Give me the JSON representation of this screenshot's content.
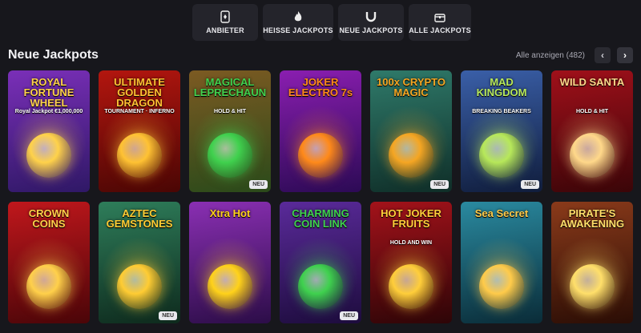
{
  "tabs": [
    {
      "label": "ANBIETER",
      "icon": "provider-icon"
    },
    {
      "label": "HEISSE JACKPOTS",
      "icon": "fire-icon"
    },
    {
      "label": "NEUE JACKPOTS",
      "icon": "horseshoe-icon"
    },
    {
      "label": "ALLE JACKPOTS",
      "icon": "treasure-chest-icon"
    }
  ],
  "section": {
    "title": "Neue Jackpots",
    "show_all": "Alle anzeigen (482)"
  },
  "badge_new": "NEU",
  "games": [
    {
      "title": "ROYAL FORTUNE WHEEL",
      "sub": "Royal Jackpot €1,000,000",
      "bg": "#7a2fb8",
      "bg2": "#2f1866",
      "accent": "#ffd24a",
      "new": false
    },
    {
      "title": "ULTIMATE GOLDEN DRAGON",
      "sub": "TOURNAMENT · INFERNO",
      "bg": "#b3160f",
      "bg2": "#4a0604",
      "accent": "#ffc233",
      "new": false
    },
    {
      "title": "MAGICAL LEPRECHAUN",
      "sub": "HOLD & HIT",
      "bg": "#7c5a22",
      "bg2": "#2a4a1a",
      "accent": "#40d14e",
      "new": true
    },
    {
      "title": "JOKER ELECTRO 7s",
      "sub": "",
      "bg": "#8a1eb0",
      "bg2": "#2c0a55",
      "accent": "#ff8a1a",
      "new": false
    },
    {
      "title": "100x CRYPTO MAGIC",
      "sub": "",
      "bg": "#2f7a6a",
      "bg2": "#0f2e28",
      "accent": "#f5a623",
      "new": true
    },
    {
      "title": "MAD KINGDOM",
      "sub": "BREAKING BEAKERS",
      "bg": "#3a5fa8",
      "bg2": "#101d3c",
      "accent": "#b7e85a",
      "new": true
    },
    {
      "title": "WILD SANTA",
      "sub": "HOLD & HIT",
      "bg": "#a0101a",
      "bg2": "#3a0508",
      "accent": "#ffd88a",
      "new": false
    },
    {
      "title": "CROWN COINS",
      "sub": "",
      "bg": "#c0171c",
      "bg2": "#4a0508",
      "accent": "#ffd04a",
      "new": false
    },
    {
      "title": "AZTEC GEMSTONES",
      "sub": "",
      "bg": "#2e7d5a",
      "bg2": "#0e2a1d",
      "accent": "#ffcc33",
      "new": true
    },
    {
      "title": "Xtra Hot",
      "sub": "",
      "bg": "#8a2fb3",
      "bg2": "#2c0d48",
      "accent": "#ffd21a",
      "new": false
    },
    {
      "title": "CHARMING COIN LINK",
      "sub": "",
      "bg": "#5a2a9a",
      "bg2": "#1d0c3d",
      "accent": "#3fd14e",
      "new": true
    },
    {
      "title": "HOT JOKER FRUITS",
      "sub": "HOLD AND WIN",
      "bg": "#a3121a",
      "bg2": "#2d0507",
      "accent": "#ffce3a",
      "new": false
    },
    {
      "title": "Sea Secret",
      "sub": "",
      "bg": "#2a8aa0",
      "bg2": "#0a2c38",
      "accent": "#ffcb4a",
      "new": false
    },
    {
      "title": "PIRATE'S AWAKENING",
      "sub": "",
      "bg": "#8a3a1a",
      "bg2": "#2a0d05",
      "accent": "#ffdf6a",
      "new": false
    }
  ]
}
